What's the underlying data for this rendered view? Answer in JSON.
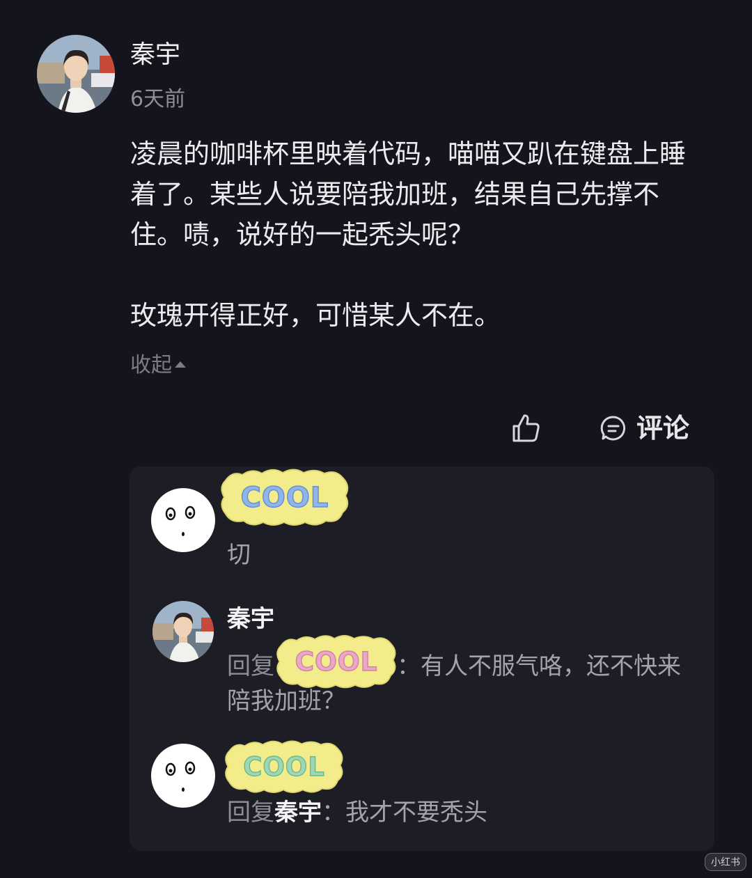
{
  "post": {
    "author": "秦宇",
    "time": "6天前",
    "paragraphs": [
      "凌晨的咖啡杯里映着代码，喵喵又趴在键盘上睡着了。某些人说要陪我加班，结果自己先撑不住。啧，说好的一起秃头呢？",
      "玫瑰开得正好，可惜某人不在。"
    ],
    "collapse_label": "收起",
    "actions": {
      "comment_label": "评论"
    }
  },
  "comments": [
    {
      "sticker_text": "COOL",
      "text": "切"
    },
    {
      "author": "秦宇",
      "reply_prefix": "回复",
      "reply_target_sticker": "COOL",
      "text": "：有人不服气咯，还不快来陪我加班？"
    },
    {
      "sticker_text": "COOL",
      "reply_prefix": "回复",
      "reply_target": "秦宇",
      "text": "：我才不要秃头"
    }
  ],
  "watermark": "小红书",
  "colors": {
    "background": "#14141c",
    "panel": "#1d1d25",
    "sticker_bg": "#f3ec8a"
  }
}
